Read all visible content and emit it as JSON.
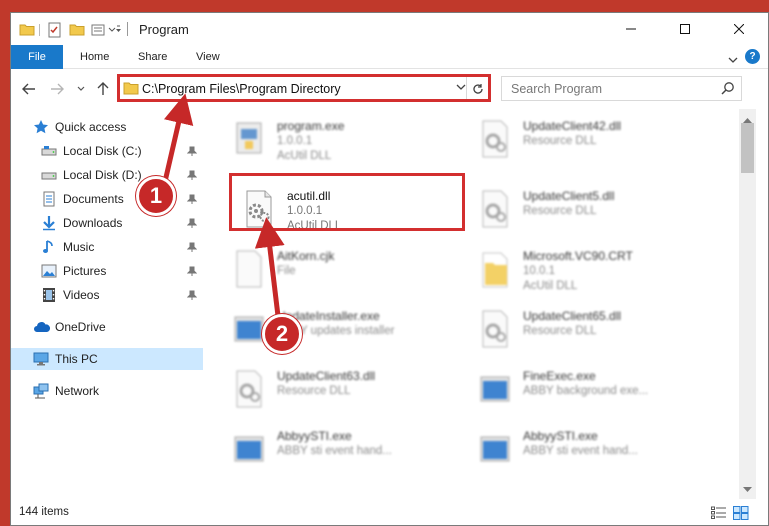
{
  "window": {
    "title": "Program"
  },
  "ribbon": {
    "tabs": [
      "File",
      "Home",
      "Share",
      "View"
    ],
    "help": "?"
  },
  "address": {
    "path": "C:\\Program Files\\Program Directory"
  },
  "search": {
    "placeholder": "Search Program"
  },
  "nav": {
    "items": [
      {
        "label": "Quick access"
      },
      {
        "label": "Local Disk (C:)"
      },
      {
        "label": "Local Disk (D:)"
      },
      {
        "label": "Documents"
      },
      {
        "label": "Downloads"
      },
      {
        "label": "Music"
      },
      {
        "label": "Pictures"
      },
      {
        "label": "Videos"
      },
      {
        "label": "OneDrive"
      },
      {
        "label": "This PC"
      },
      {
        "label": "Network"
      }
    ]
  },
  "files": [
    {
      "name": "program.exe",
      "line1": "1.0.0.1",
      "line2": "AcUtil DLL"
    },
    {
      "name": "UpdateClient42.dll",
      "line1": "Resource DLL",
      "line2": ""
    },
    {
      "name": "acutil.dll",
      "line1": "1.0.0.1",
      "line2": "AcUtil DLL"
    },
    {
      "name": "UpdateClient5.dll",
      "line1": "Resource DLL",
      "line2": ""
    },
    {
      "name": "AitKorn.cjk",
      "line1": "File",
      "line2": ""
    },
    {
      "name": "Microsoft.VC90.CRT",
      "line1": "10.0.1",
      "line2": "AcUtil DLL"
    },
    {
      "name": "UpdateInstaller.exe",
      "line1": "ABBY updates installer",
      "line2": ""
    },
    {
      "name": "UpdateClient65.dll",
      "line1": "Resource DLL",
      "line2": ""
    },
    {
      "name": "UpdateClient63.dll",
      "line1": "Resource DLL",
      "line2": ""
    },
    {
      "name": "FineExec.exe",
      "line1": "ABBY background exe...",
      "line2": ""
    },
    {
      "name": "AbbyySTI.exe",
      "line1": "ABBY sti event hand...",
      "line2": ""
    },
    {
      "name": "AbbyySTI.exe",
      "line1": "ABBY sti event hand...",
      "line2": ""
    }
  ],
  "status": {
    "count": "144 items"
  },
  "callouts": {
    "one": "1",
    "two": "2"
  },
  "colors": {
    "accent": "#1979ca",
    "callout": "#c62828",
    "selected": "#cce8ff"
  }
}
